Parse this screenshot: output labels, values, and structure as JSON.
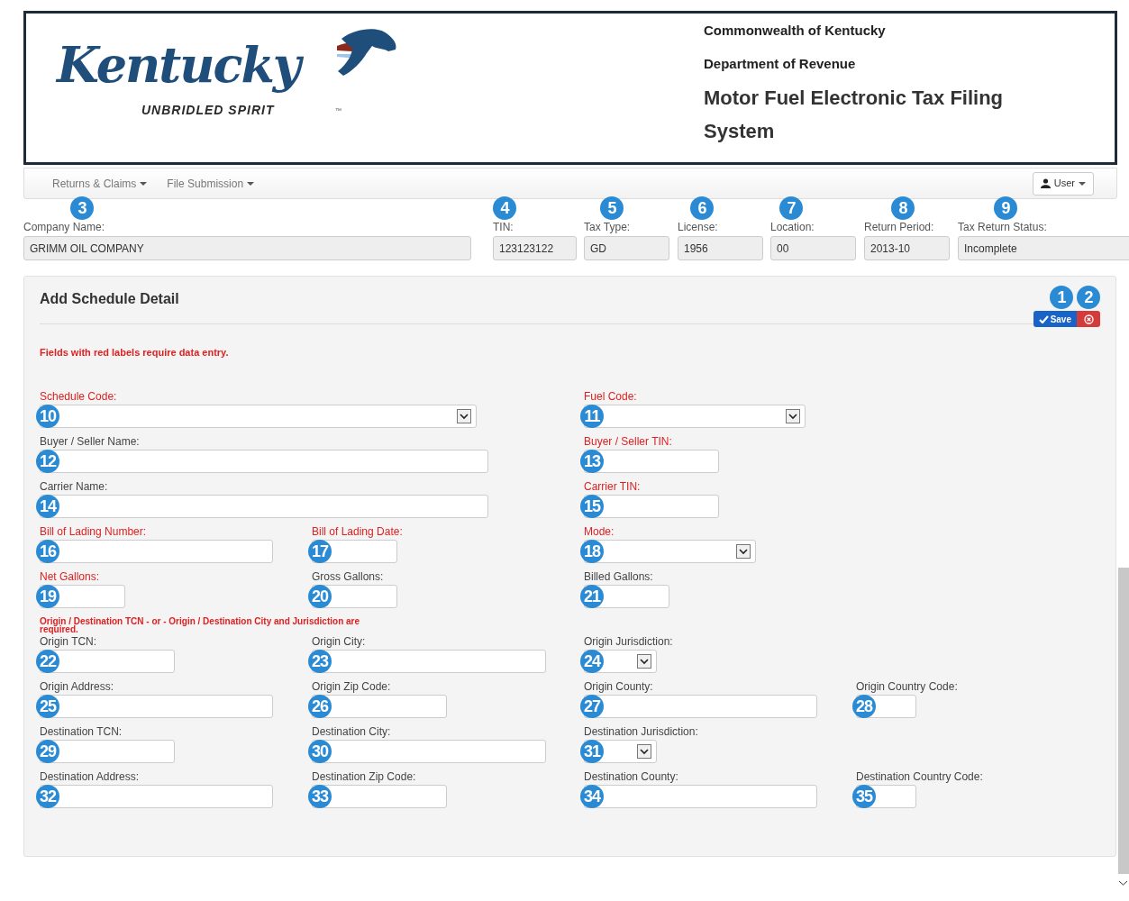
{
  "header": {
    "logo": {
      "word": "Kentucky",
      "tagline": "UNBRIDLED SPIRIT",
      "mark": "™"
    },
    "lines": [
      "Commonwealth of Kentucky",
      "Department of Revenue"
    ],
    "title": "Motor Fuel Electronic Tax Filing System"
  },
  "nav": {
    "menus": [
      "Returns & Claims",
      "File Submission"
    ],
    "user": "User"
  },
  "info": [
    {
      "marker": "3",
      "label": "Company Name:",
      "value": "GRIMM OIL COMPANY"
    },
    {
      "marker": "4",
      "label": "TIN:",
      "value": "123123122"
    },
    {
      "marker": "5",
      "label": "Tax Type:",
      "value": "GD"
    },
    {
      "marker": "6",
      "label": "License:",
      "value": "1956"
    },
    {
      "marker": "7",
      "label": "Location:",
      "value": "00"
    },
    {
      "marker": "8",
      "label": "Return Period:",
      "value": "2013-10"
    },
    {
      "marker": "9",
      "label": "Tax Return Status:",
      "value": "Incomplete"
    }
  ],
  "panel": {
    "title": "Add Schedule Detail",
    "save": {
      "marker": "1",
      "label": "Save"
    },
    "cancel": {
      "marker": "2"
    },
    "required_note": "Fields with red labels require data entry.",
    "rows": [
      [
        {
          "label": "Schedule Code:",
          "required": true,
          "kind": "select",
          "marker": "10"
        },
        {
          "label": "Fuel Code:",
          "required": true,
          "kind": "select",
          "marker": "11"
        }
      ],
      [
        {
          "label": "Buyer / Seller Name:",
          "required": false,
          "kind": "text",
          "marker": "12"
        },
        {
          "label": "Buyer / Seller TIN:",
          "required": true,
          "kind": "text",
          "marker": "13"
        }
      ],
      [
        {
          "label": "Carrier Name:",
          "required": false,
          "kind": "text",
          "marker": "14"
        },
        {
          "label": "Carrier TIN:",
          "required": true,
          "kind": "text",
          "marker": "15"
        }
      ],
      [
        {
          "label": "Bill of Lading Number:",
          "required": true,
          "kind": "text",
          "marker": "16"
        },
        {
          "label": "Bill of Lading Date:",
          "required": true,
          "kind": "text",
          "marker": "17"
        },
        {
          "label": "Mode:",
          "required": true,
          "kind": "select",
          "marker": "18"
        }
      ],
      [
        {
          "label": "Net Gallons:",
          "required": true,
          "kind": "text",
          "marker": "19"
        },
        {
          "label": "Gross Gallons:",
          "required": false,
          "kind": "text",
          "marker": "20"
        },
        {
          "label": "Billed Gallons:",
          "required": false,
          "kind": "text",
          "marker": "21"
        }
      ],
      {
        "note": "Origin / Destination TCN - or - Origin / Destination City and Jurisdiction are required."
      },
      [
        {
          "label": "Origin TCN:",
          "required": false,
          "kind": "text",
          "marker": "22"
        },
        {
          "label": "Origin City:",
          "required": false,
          "kind": "text",
          "marker": "23"
        },
        {
          "label": "Origin Jurisdiction:",
          "required": false,
          "kind": "select",
          "marker": "24"
        }
      ],
      [
        {
          "label": "Origin Address:",
          "required": false,
          "kind": "text",
          "marker": "25"
        },
        {
          "label": "Origin Zip Code:",
          "required": false,
          "kind": "text",
          "marker": "26"
        },
        {
          "label": "Origin County:",
          "required": false,
          "kind": "text",
          "marker": "27"
        },
        {
          "label": "Origin Country Code:",
          "required": false,
          "kind": "text",
          "marker": "28"
        }
      ],
      [
        {
          "label": "Destination TCN:",
          "required": false,
          "kind": "text",
          "marker": "29"
        },
        {
          "label": "Destination City:",
          "required": false,
          "kind": "text",
          "marker": "30"
        },
        {
          "label": "Destination Jurisdiction:",
          "required": false,
          "kind": "select",
          "marker": "31"
        }
      ],
      [
        {
          "label": "Destination Address:",
          "required": false,
          "kind": "text",
          "marker": "32"
        },
        {
          "label": "Destination Zip Code:",
          "required": false,
          "kind": "text",
          "marker": "33"
        },
        {
          "label": "Destination County:",
          "required": false,
          "kind": "text",
          "marker": "34"
        },
        {
          "label": "Destination Country Code:",
          "required": false,
          "kind": "text",
          "marker": "35"
        }
      ]
    ]
  }
}
